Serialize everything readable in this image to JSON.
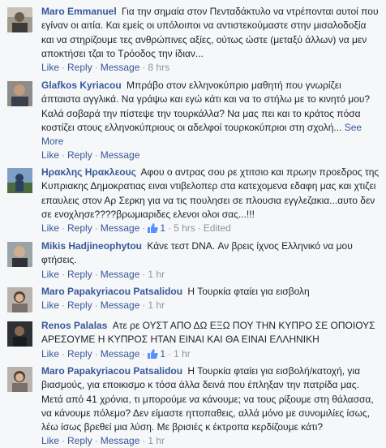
{
  "actions": {
    "like": "Like",
    "reply": "Reply",
    "message": "Message",
    "dot": "·"
  },
  "colors": {
    "link": "#365899",
    "meta": "#90949c",
    "text": "#1d2129",
    "background": "#f6f7f9"
  },
  "comments": [
    {
      "author": "Maro Emmanuel",
      "text": "Για την σημαία στον Πενταδάκτυλο να ντρέπονται αυτοί που εγίναν οι αιτία. Και εμείς οι υπόλοιποι να αντιστεκούμαστε στην μισαλοδοξία και να στηρίζουμε τες ανθρώπινες αξίες, ούτως ώστε (μεταξύ άλλων) να μεν αποκτήσει τζαι το Τρόοδος την ίδιαν...",
      "time": "8 hrs",
      "avatar_icon": "profile-photo-icon"
    },
    {
      "author": "Glafkos Kyriacou",
      "text": "Μπράβο στον ελληνοκύπριο μαθητή που γνωρίζει άπταιστα αγγλικά. Να γράψω και εγώ κάτι και να το στήλω με το κινητό μου? Καλά σοβαρά την πίστεψε την τουρκάλλα? Να μας πει και το κράτος πόσα κοστίζει στους ελληνοκύπριους οι αδελφοί τουρκοκύπριοι στη σχολή...",
      "see_more": "See More",
      "avatar_icon": "profile-photo-icon"
    },
    {
      "author": "Ηρακλης Ηρακλεους",
      "text": "Αφου ο αντρας σου ρε χτιτσιο και πρωην προεδρος της Κυπριακης Δημοκρατιας ειναι ντιβελοπερ στα κατεχομενα εδαφη μας και χτιζει επαυλεις στον Αρ Σερκη για να τις πουλησει σε πλουσια εγγλεζακια...αυτο δεν σε ενοχλησε????βρωμιαριδες ελενοι ολοι σας...!!!",
      "likes": "1",
      "time": "5 hrs",
      "edited": "Edited",
      "avatar_icon": "profile-photo-icon"
    },
    {
      "author": "Mikis Hadjineophytou",
      "text": "Κάνε τεστ DNA. Αν βρεις ίχνος Ελληνικό να μου φτήσεις.",
      "time": "1 hr",
      "avatar_icon": "profile-photo-icon"
    },
    {
      "author": "Maro Papakyriacou Patsalidou",
      "text": "Η Τουρκία φταίει για εισβολη",
      "time": "1 hr",
      "avatar_icon": "profile-photo-icon"
    },
    {
      "author": "Renos Palalas",
      "text": "Ατε ρε ΟΥΣΤ ΑΠΟ ΔΩ ΕΞΩ ΠΟΥ ΤΗΝ ΚΥΠΡΟ ΣΕ ΟΠΟΙΟΥΣ ΑΡΕΣΟΥΜΕ Η ΚΥΠΡΟΣ ΗΤΑΝ ΕΙΝΑΙ ΚΑΙ ΘΑ ΕΙΝΑΙ ΕΛΛΗΝΙΚΗ",
      "likes": "1",
      "time": "1 hr",
      "avatar_icon": "profile-photo-icon"
    },
    {
      "author": "Maro Papakyriacou Patsalidou",
      "text": "Η Τουρκία φταίει για εισβολή/κατοχή, για βιασμούς, για εποικισμο κ τόσα άλλα δεινά που έπληξαν την πατρίδα μας. Μετά από 41 χρόνια, τι μπορούμε να κάνουμε; να τους ρίξουμε στη θάλασσα, να κάνουμε πόλεμο? Δεν είμαστε ηττοπαθεις, αλλά μόνο με συνομιλίες ίσως, λέω ίσως βρεθεί μια λύση. Με βρισιές κ έκτροπα κερδίζουμε κάτι?",
      "time": "1 hr",
      "avatar_icon": "profile-photo-icon"
    }
  ]
}
